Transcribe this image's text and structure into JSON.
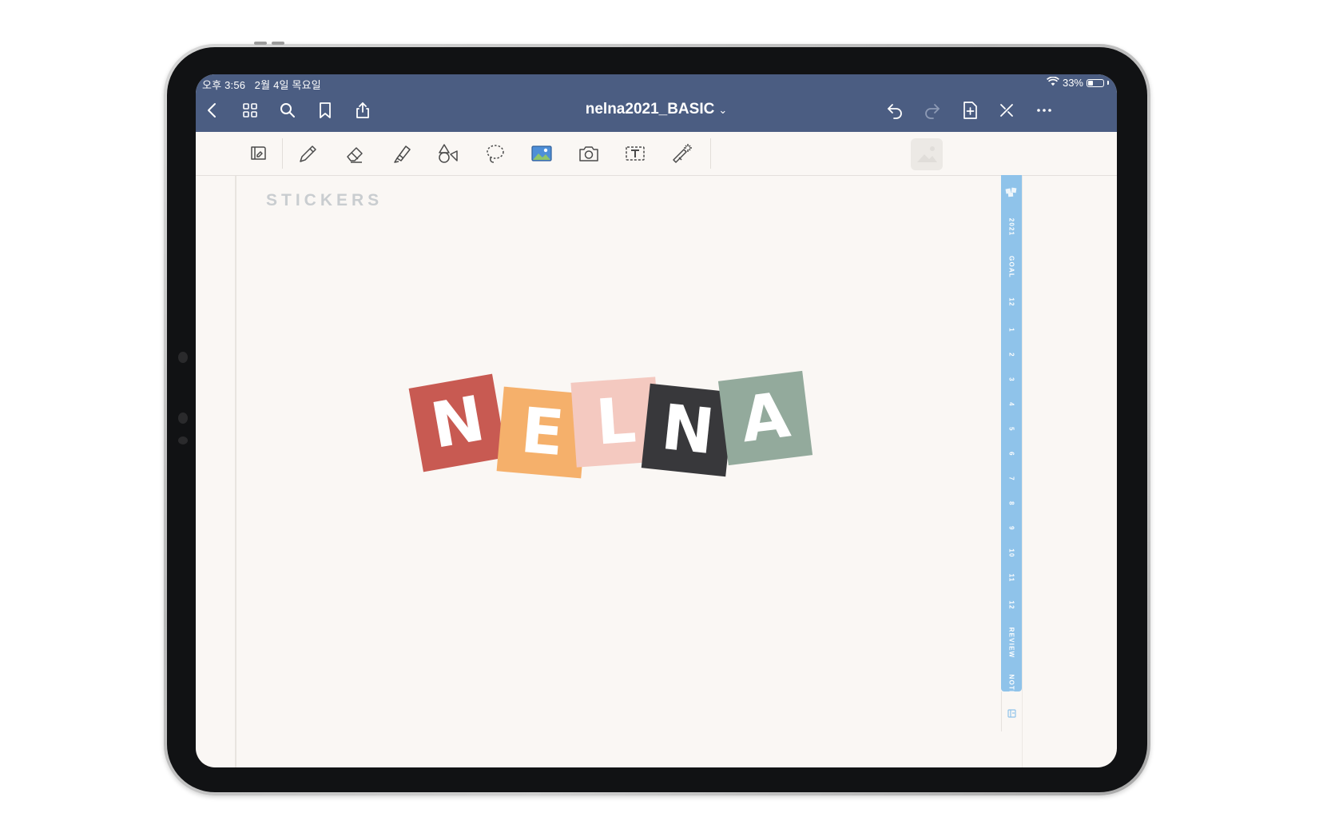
{
  "status_bar": {
    "time": "오후 3:56",
    "date": "2월 4일 목요일",
    "battery_text": "33%",
    "battery_level": 0.33
  },
  "nav": {
    "document_title": "nelna2021_BASIC",
    "title_chevron": "⌄"
  },
  "page": {
    "heading": "STICKERS"
  },
  "sticker": {
    "letters": [
      {
        "char": "N",
        "color": "#c85a52"
      },
      {
        "char": "E",
        "color": "#f5b06b"
      },
      {
        "char": "L",
        "color": "#f4c9c0"
      },
      {
        "char": "N",
        "color": "#38383b"
      },
      {
        "char": "A",
        "color": "#93aa9c"
      }
    ]
  },
  "side_tabs": {
    "items": [
      "2021",
      "GOAL",
      "12",
      "1",
      "2",
      "3",
      "4",
      "5",
      "6",
      "7",
      "8",
      "9",
      "10",
      "11",
      "12",
      "REVIEW",
      "NOTE"
    ],
    "color": "#8fc3ea"
  },
  "colors": {
    "nav_bar": "#4b5d82",
    "paper": "#faf7f4",
    "heading_gray": "#c9cdd0"
  }
}
